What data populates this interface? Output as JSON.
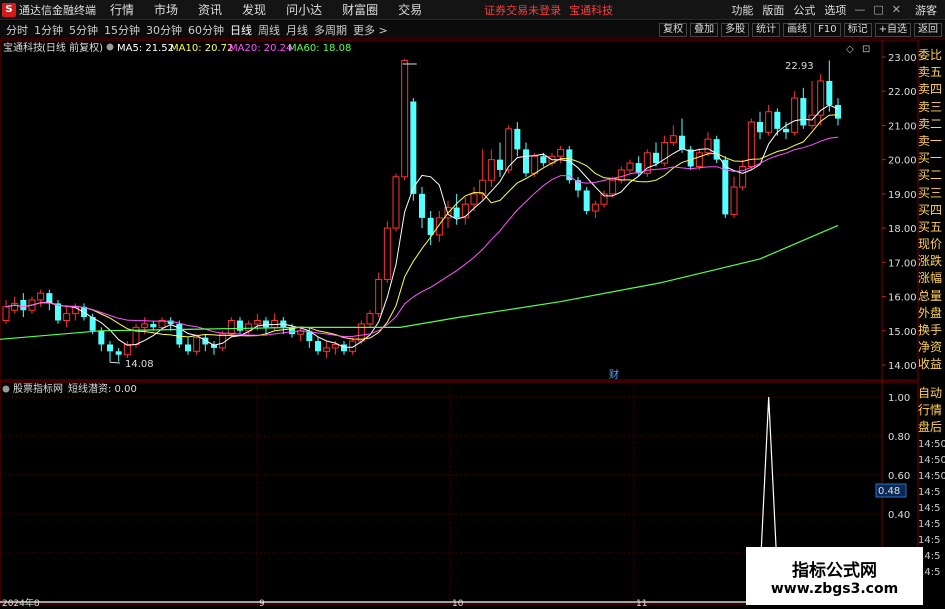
{
  "titlebar": {
    "logo": "S",
    "app_title": "通达信金融终端",
    "menus": [
      "行情",
      "市场",
      "资讯",
      "发现",
      "问小达",
      "财富圈",
      "交易"
    ],
    "warning": "证券交易未登录",
    "stock_name": "宝通科技",
    "right_menus": [
      "功能",
      "版面",
      "公式",
      "选项"
    ],
    "guest": "游客"
  },
  "periodbar": {
    "periods": [
      "分时",
      "1分钟",
      "5分钟",
      "15分钟",
      "30分钟",
      "60分钟",
      "日线",
      "周线",
      "月线",
      "多周期",
      "更多 >"
    ],
    "active": "日线",
    "right_buttons": [
      "复权",
      "叠加",
      "多股",
      "统计",
      "画线",
      "F10",
      "标记",
      "+自选",
      "返回"
    ]
  },
  "kline_panel": {
    "header_stock": "宝通科技",
    "header_mode": "(日线 前复权)",
    "ma5": "MA5: 21.52",
    "ma10": "MA10: 20.72",
    "ma20": "MA20: 20.24",
    "ma60": "MA60: 18.08",
    "high_label": "22.93",
    "low_label": "14.08",
    "finance_marker": "财",
    "y_ticks": [
      "23.00",
      "22.00",
      "21.00",
      "20.00",
      "19.00",
      "18.00",
      "17.00",
      "16.00",
      "15.00",
      "14.00"
    ]
  },
  "indicator_panel": {
    "name": "股票指标网",
    "formula": "短线潜资: 0.00",
    "y_ticks": [
      "1.00",
      "0.80",
      "0.60",
      "0.40",
      "0.20"
    ],
    "current_value": "0.48"
  },
  "x_axis": [
    "2024年8",
    "9",
    "10",
    "11"
  ],
  "right_list": [
    "委比",
    "卖五",
    "卖四",
    "卖三",
    "卖二",
    "卖一",
    "买一",
    "买二",
    "买三",
    "买四",
    "买五",
    "现价",
    "涨跌",
    "涨幅",
    "总量",
    "外盘",
    "换手",
    "净资",
    "收益"
  ],
  "right_list2": [
    "自动",
    "行情",
    "盘后"
  ],
  "time_list": [
    "14:50",
    "14:50",
    "14:50",
    "14:5",
    "14:5",
    "14:5",
    "14:5",
    "14:5",
    "14:5"
  ],
  "watermark": {
    "line1": "指标公式网",
    "line2": "www.zbgs3.com"
  },
  "colors": {
    "up": "#ff3232",
    "down": "#54ffff",
    "ma5": "#ffffff",
    "ma10": "#ffff54",
    "ma20": "#ff54ff",
    "ma60": "#54ff54",
    "grid": "#7a0000"
  },
  "chart_data": {
    "type": "candlestick",
    "candles": [
      [
        15.3,
        15.7,
        15.2,
        15.9
      ],
      [
        15.6,
        15.8,
        15.5,
        16.0
      ],
      [
        15.9,
        15.6,
        15.4,
        16.1
      ],
      [
        15.6,
        15.9,
        15.5,
        16.0
      ],
      [
        15.9,
        16.1,
        15.7,
        16.2
      ],
      [
        16.1,
        15.8,
        15.6,
        16.2
      ],
      [
        15.8,
        15.3,
        15.2,
        15.9
      ],
      [
        15.3,
        15.5,
        15.1,
        15.7
      ],
      [
        15.5,
        15.7,
        15.3,
        15.8
      ],
      [
        15.7,
        15.4,
        15.3,
        15.8
      ],
      [
        15.4,
        15.0,
        14.9,
        15.5
      ],
      [
        15.0,
        14.6,
        14.4,
        15.1
      ],
      [
        14.6,
        14.4,
        14.08,
        14.7
      ],
      [
        14.4,
        14.3,
        14.1,
        14.5
      ],
      [
        14.3,
        14.6,
        14.2,
        14.7
      ],
      [
        14.6,
        15.1,
        14.5,
        15.2
      ],
      [
        15.1,
        15.2,
        14.9,
        15.4
      ],
      [
        15.2,
        15.1,
        15.0,
        15.3
      ],
      [
        15.1,
        15.3,
        15.0,
        15.4
      ],
      [
        15.3,
        15.2,
        15.0,
        15.4
      ],
      [
        15.2,
        14.6,
        14.5,
        15.3
      ],
      [
        14.6,
        14.4,
        14.3,
        14.8
      ],
      [
        14.4,
        14.8,
        14.3,
        14.9
      ],
      [
        14.8,
        14.6,
        14.4,
        14.9
      ],
      [
        14.6,
        14.5,
        14.3,
        14.7
      ],
      [
        14.5,
        14.9,
        14.4,
        15.0
      ],
      [
        14.9,
        15.3,
        14.8,
        15.4
      ],
      [
        15.3,
        15.0,
        14.9,
        15.4
      ],
      [
        15.0,
        15.2,
        14.9,
        15.3
      ],
      [
        15.2,
        15.3,
        15.0,
        15.5
      ],
      [
        15.3,
        15.1,
        14.9,
        15.4
      ],
      [
        15.1,
        15.3,
        15.0,
        15.5
      ],
      [
        15.3,
        15.1,
        14.9,
        15.4
      ],
      [
        15.1,
        14.9,
        14.8,
        15.2
      ],
      [
        14.9,
        15.0,
        14.7,
        15.1
      ],
      [
        15.0,
        14.7,
        14.5,
        15.1
      ],
      [
        14.7,
        14.4,
        14.3,
        14.8
      ],
      [
        14.4,
        14.5,
        14.2,
        14.7
      ],
      [
        14.5,
        14.6,
        14.3,
        14.7
      ],
      [
        14.6,
        14.4,
        14.3,
        14.7
      ],
      [
        14.4,
        14.7,
        14.3,
        14.8
      ],
      [
        14.7,
        15.2,
        14.6,
        15.3
      ],
      [
        15.2,
        15.5,
        15.1,
        15.6
      ],
      [
        15.5,
        16.5,
        15.4,
        16.7
      ],
      [
        16.5,
        18.0,
        16.4,
        18.2
      ],
      [
        18.0,
        19.5,
        17.9,
        19.6
      ],
      [
        19.5,
        22.9,
        19.4,
        22.95
      ],
      [
        21.7,
        19.0,
        18.8,
        21.8
      ],
      [
        19.0,
        18.3,
        18.0,
        19.2
      ],
      [
        18.3,
        17.8,
        17.5,
        18.5
      ],
      [
        17.8,
        18.3,
        17.6,
        18.5
      ],
      [
        18.3,
        18.6,
        18.0,
        18.8
      ],
      [
        18.6,
        18.3,
        18.1,
        19.0
      ],
      [
        18.3,
        18.7,
        18.1,
        18.9
      ],
      [
        18.7,
        19.0,
        18.5,
        19.2
      ],
      [
        19.0,
        19.4,
        18.8,
        20.3
      ],
      [
        19.4,
        20.0,
        19.2,
        20.3
      ],
      [
        20.0,
        19.7,
        19.5,
        20.5
      ],
      [
        19.7,
        20.9,
        19.6,
        21.0
      ],
      [
        20.9,
        20.3,
        20.1,
        21.1
      ],
      [
        20.3,
        19.6,
        19.5,
        20.5
      ],
      [
        19.6,
        20.1,
        19.5,
        20.2
      ],
      [
        20.1,
        19.9,
        19.8,
        20.2
      ],
      [
        19.9,
        20.1,
        19.8,
        20.2
      ],
      [
        20.1,
        20.3,
        19.9,
        20.4
      ],
      [
        20.3,
        19.4,
        19.3,
        20.4
      ],
      [
        19.4,
        19.1,
        18.9,
        19.5
      ],
      [
        19.1,
        18.5,
        18.4,
        19.2
      ],
      [
        18.5,
        18.7,
        18.3,
        18.8
      ],
      [
        18.7,
        19.0,
        18.6,
        19.1
      ],
      [
        19.0,
        19.4,
        18.9,
        19.5
      ],
      [
        19.4,
        19.7,
        19.3,
        19.8
      ],
      [
        19.7,
        19.9,
        19.6,
        20.0
      ],
      [
        19.9,
        19.6,
        19.5,
        20.1
      ],
      [
        19.6,
        20.2,
        19.5,
        20.3
      ],
      [
        20.2,
        19.9,
        19.8,
        20.5
      ],
      [
        19.9,
        20.5,
        19.8,
        20.7
      ],
      [
        20.5,
        20.7,
        20.4,
        21.0
      ],
      [
        20.7,
        20.3,
        20.2,
        21.2
      ],
      [
        20.3,
        19.8,
        19.7,
        20.4
      ],
      [
        19.8,
        20.2,
        19.7,
        20.3
      ],
      [
        20.2,
        20.6,
        20.1,
        20.8
      ],
      [
        20.6,
        20.0,
        19.9,
        20.7
      ],
      [
        20.0,
        18.4,
        18.3,
        20.1
      ],
      [
        18.4,
        19.2,
        18.3,
        19.5
      ],
      [
        19.2,
        19.8,
        19.1,
        20.0
      ],
      [
        19.8,
        21.1,
        19.7,
        21.2
      ],
      [
        21.1,
        20.8,
        20.6,
        21.4
      ],
      [
        20.8,
        21.4,
        20.7,
        21.6
      ],
      [
        21.4,
        20.9,
        20.7,
        21.5
      ],
      [
        20.9,
        20.8,
        20.6,
        21.1
      ],
      [
        20.8,
        21.8,
        20.7,
        22.0
      ],
      [
        21.8,
        21.0,
        20.9,
        22.1
      ],
      [
        21.0,
        21.3,
        20.9,
        22.3
      ],
      [
        21.3,
        22.3,
        21.0,
        22.5
      ],
      [
        22.3,
        21.6,
        21.4,
        22.9
      ],
      [
        21.6,
        21.2,
        21.0,
        21.8
      ]
    ],
    "ma60": [
      [
        0,
        14.75
      ],
      [
        100,
        15.0
      ],
      [
        200,
        15.05
      ],
      [
        300,
        15.1
      ],
      [
        400,
        15.1
      ],
      [
        460,
        15.4
      ],
      [
        560,
        15.85
      ],
      [
        660,
        16.4
      ],
      [
        760,
        17.1
      ],
      [
        838,
        18.08
      ]
    ],
    "indicator_spike": {
      "at_index": 88,
      "value": 1.0
    }
  }
}
